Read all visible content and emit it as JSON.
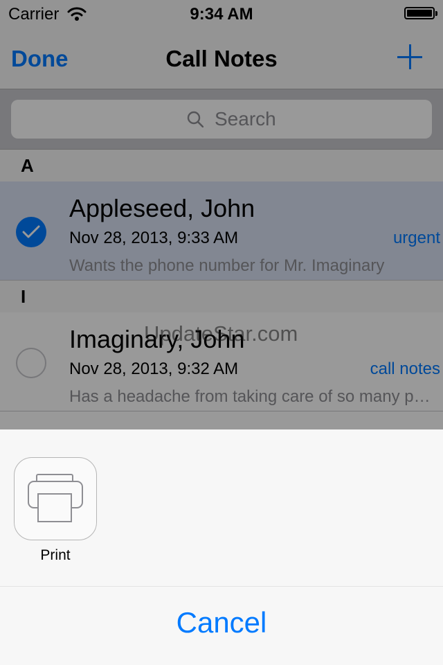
{
  "status_bar": {
    "carrier": "Carrier",
    "time": "9:34 AM"
  },
  "nav": {
    "left_button": "Done",
    "title": "Call Notes",
    "right_icon": "plus-icon"
  },
  "search": {
    "placeholder": "Search"
  },
  "sections": [
    {
      "header": "A",
      "rows": [
        {
          "name": "Appleseed, John",
          "date": "Nov 28, 2013, 9:33 AM",
          "tag": "urgent",
          "note": "Wants the phone number for Mr. Imaginary",
          "checked": true
        }
      ]
    },
    {
      "header": "I",
      "rows": [
        {
          "name": "Imaginary, John",
          "date": "Nov 28, 2013, 9:32 AM",
          "tag": "call notes",
          "note": "Has a headache from taking care of so many p…",
          "checked": false
        }
      ]
    }
  ],
  "watermark": "UpdateStar.com",
  "share_sheet": {
    "activities": [
      {
        "label": "Print",
        "icon": "printer-icon"
      }
    ],
    "cancel_label": "Cancel"
  },
  "colors": {
    "accent": "#007aff",
    "selected_row": "#d9e2f4",
    "search_bar": "#c9c9ce",
    "overlay": "rgba(0,0,0,0.40)"
  }
}
